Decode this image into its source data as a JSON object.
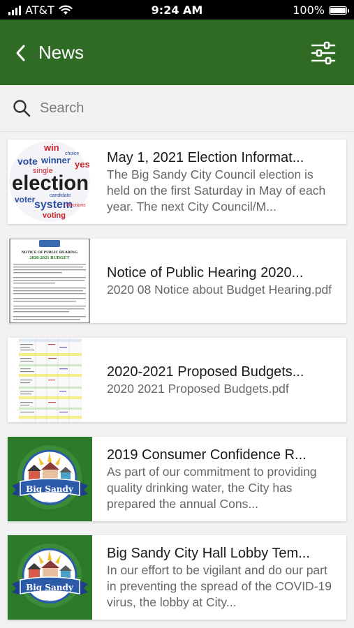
{
  "status_bar": {
    "carrier": "AT&T",
    "time": "9:24 AM",
    "battery": "100%",
    "battery_level": 1.0
  },
  "header": {
    "title": "News",
    "back_icon": "chevron-left-icon",
    "filter_icon": "sliders-icon",
    "background_color": "#2f6b25"
  },
  "search": {
    "placeholder": "Search",
    "value": ""
  },
  "news": [
    {
      "title": "May 1, 2021 Election Informat...",
      "description": "The Big Sandy City Council election is held on the first Saturday in May of each year. The next City Council/M...",
      "thumbnail": "election-word-cloud",
      "thumb_words": {
        "w1": "win",
        "w2": "vote",
        "w3": "winner",
        "w4": "yes",
        "w5": "single",
        "w6": "election",
        "w7": "voter",
        "w8": "system",
        "w9": "choice",
        "w10": "voting",
        "w11": "candidate",
        "w12": "elections"
      }
    },
    {
      "title": "Notice of Public Hearing 2020...",
      "description": "2020 08 Notice about Budget Hearing.pdf",
      "thumbnail": "notice-document",
      "thumb_heading": "NOTICE OF PUBLIC HEARING",
      "thumb_subheading": "2020-2021 BUDGET"
    },
    {
      "title": "2020-2021 Proposed Budgets...",
      "description": "2020 2021 Proposed Budgets.pdf",
      "thumbnail": "spreadsheet-document"
    },
    {
      "title": "2019 Consumer Confidence R...",
      "description": "As part of our commitment to providing quality drinking water, the City has prepared the annual Cons...",
      "thumbnail": "big-sandy-logo",
      "logo_text": "Big Sandy",
      "logo_sub": "TEXAS"
    },
    {
      "title": "Big Sandy City Hall Lobby Tem...",
      "description": "In our effort to be vigilant and do our part in preventing the spread of the COVID-19 virus, the lobby at City...",
      "thumbnail": "big-sandy-logo",
      "logo_text": "Big Sandy",
      "logo_sub": "TEXAS"
    }
  ]
}
